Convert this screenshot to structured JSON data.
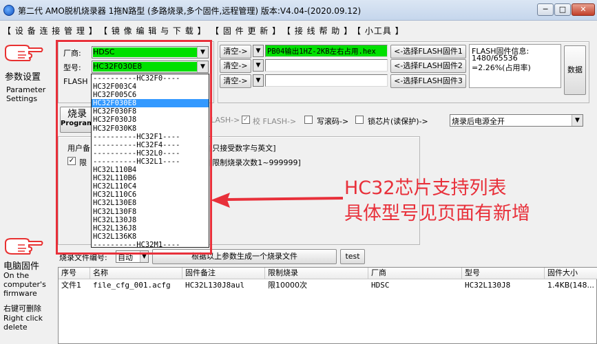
{
  "window": {
    "title": "第二代 AMO脱机烧录器 1拖N路型 (多路烧录,多个固件,远程管理)  版本:V4.04-(2020.09.12)",
    "min": "─",
    "max": "□",
    "close": "✕"
  },
  "menu": [
    "【 设 备 连 接 管 理 】",
    "【 镜 像 编 辑 与 下 载 】",
    "【 固 件 更 新 】",
    "【 接 线 帮 助 】",
    "【 小工具 】"
  ],
  "sidebar": {
    "param_cn": "参数设置",
    "param_en1": "Parameter",
    "param_en2": "Settings",
    "fw_cn": "电脑固件",
    "fw_en1": "On the",
    "fw_en2": "computer's",
    "fw_en3": "firmware",
    "del_cn": "右键可删除",
    "del_en1": "Right click",
    "del_en2": "delete"
  },
  "form": {
    "vendor_label": "厂商:",
    "vendor_value": "HDSC",
    "model_label": "型号:",
    "model_value": "HC32F030E8",
    "flash_label": "FLASH",
    "clear_label": "清空->",
    "fw1_value": "PB04输出1HZ-2KB左右占用.hex",
    "select1": "<-选择FLASH固件1",
    "select2": "<-选择FLASH固件2",
    "select3": "<-选择FLASH固件3",
    "flash_info_title": "FLASH固件信息:",
    "flash_info_size": "1480/65536",
    "flash_info_pct": "=2.26%(占用率)",
    "data_btn": "数据",
    "program_btn_cn": "烧录",
    "program_btn_en": "Program",
    "flash_step": "LASH->",
    "verify_label": "校 FLASH->",
    "write_roll_label": "写滚码->",
    "lock_label": "锁芯片(读保护)->",
    "after_value": "烧录后电源全开",
    "user_label": "用户备",
    "limit_label": "限",
    "user_hint": "[只接受数字与英文]",
    "limit_hint": "[限制烧录次数1~999999]",
    "file_label": "烧录文件编号:",
    "file_value": "自动",
    "gen_btn": "根据以上参数生成一个烧录文件",
    "test_btn": "test"
  },
  "model_options": [
    "----------HC32F0----",
    "HC32F003C4",
    "HC32F005C6",
    "HC32F030E8",
    "HC32F030F8",
    "HC32F030J8",
    "HC32F030K8",
    "----------HC32F1----",
    "----------HC32F4----",
    "----------HC32L0----",
    "----------HC32L1----",
    "HC32L110B4",
    "HC32L110B6",
    "HC32L110C4",
    "HC32L110C6",
    "HC32L130E8",
    "HC32L130F8",
    "HC32L130J8",
    "HC32L136J8",
    "HC32L136K8",
    "----------HC32M1----"
  ],
  "selected_option": "HC32F030E8",
  "annotation": {
    "line1": "HC32芯片支持列表",
    "line2": "具体型号见页面有新增"
  },
  "table": {
    "headers": [
      "序号",
      "名称",
      "固件备注",
      "限制烧录",
      "厂商",
      "型号",
      "固件大小"
    ],
    "rows": [
      [
        "文件1",
        "file_cfg_001.acfg",
        "HC32L130J8aul",
        "限10000次",
        "HDSC",
        "HC32L130J8",
        "1.4KB(148..."
      ]
    ]
  },
  "colors": {
    "accent_red": "#e8303a",
    "selected_blue": "#3399ff",
    "green_field": "#00e000"
  }
}
